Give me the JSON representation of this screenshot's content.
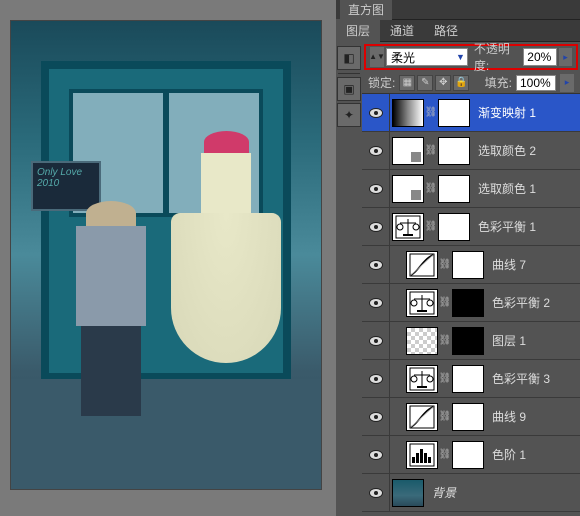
{
  "top_tabs": {
    "histogram": "直方图"
  },
  "panel_tabs": {
    "layers": "图层",
    "channels": "通道",
    "paths": "路径"
  },
  "blend_row": {
    "mode": "柔光",
    "opacity_label": "不透明度:",
    "opacity_value": "20%"
  },
  "lock_row": {
    "label": "锁定:",
    "fill_label": "填充:",
    "fill_value": "100%"
  },
  "sign_text": "Only Love 2010",
  "layers": [
    {
      "name": "渐变映射 1",
      "type": "gradient",
      "mask": "white",
      "selected": true,
      "indent": 0
    },
    {
      "name": "选取颜色 2",
      "type": "selcolor",
      "mask": "white",
      "selected": false,
      "indent": 0
    },
    {
      "name": "选取颜色 1",
      "type": "selcolor",
      "mask": "white",
      "selected": false,
      "indent": 0
    },
    {
      "name": "色彩平衡 1",
      "type": "balance",
      "mask": "white",
      "selected": false,
      "indent": 0
    },
    {
      "name": "曲线 7",
      "type": "curves",
      "mask": "white",
      "selected": false,
      "indent": 1
    },
    {
      "name": "色彩平衡 2",
      "type": "balance",
      "mask": "black",
      "selected": false,
      "indent": 1
    },
    {
      "name": "图层 1",
      "type": "checker",
      "mask": "black",
      "selected": false,
      "indent": 1
    },
    {
      "name": "色彩平衡 3",
      "type": "balance",
      "mask": "white",
      "selected": false,
      "indent": 1
    },
    {
      "name": "曲线 9",
      "type": "curves",
      "mask": "white",
      "selected": false,
      "indent": 1
    },
    {
      "name": "色阶 1",
      "type": "levels",
      "mask": "white",
      "selected": false,
      "indent": 1
    },
    {
      "name": "背景",
      "type": "photo",
      "mask": null,
      "selected": false,
      "indent": 0,
      "bg": true
    }
  ]
}
